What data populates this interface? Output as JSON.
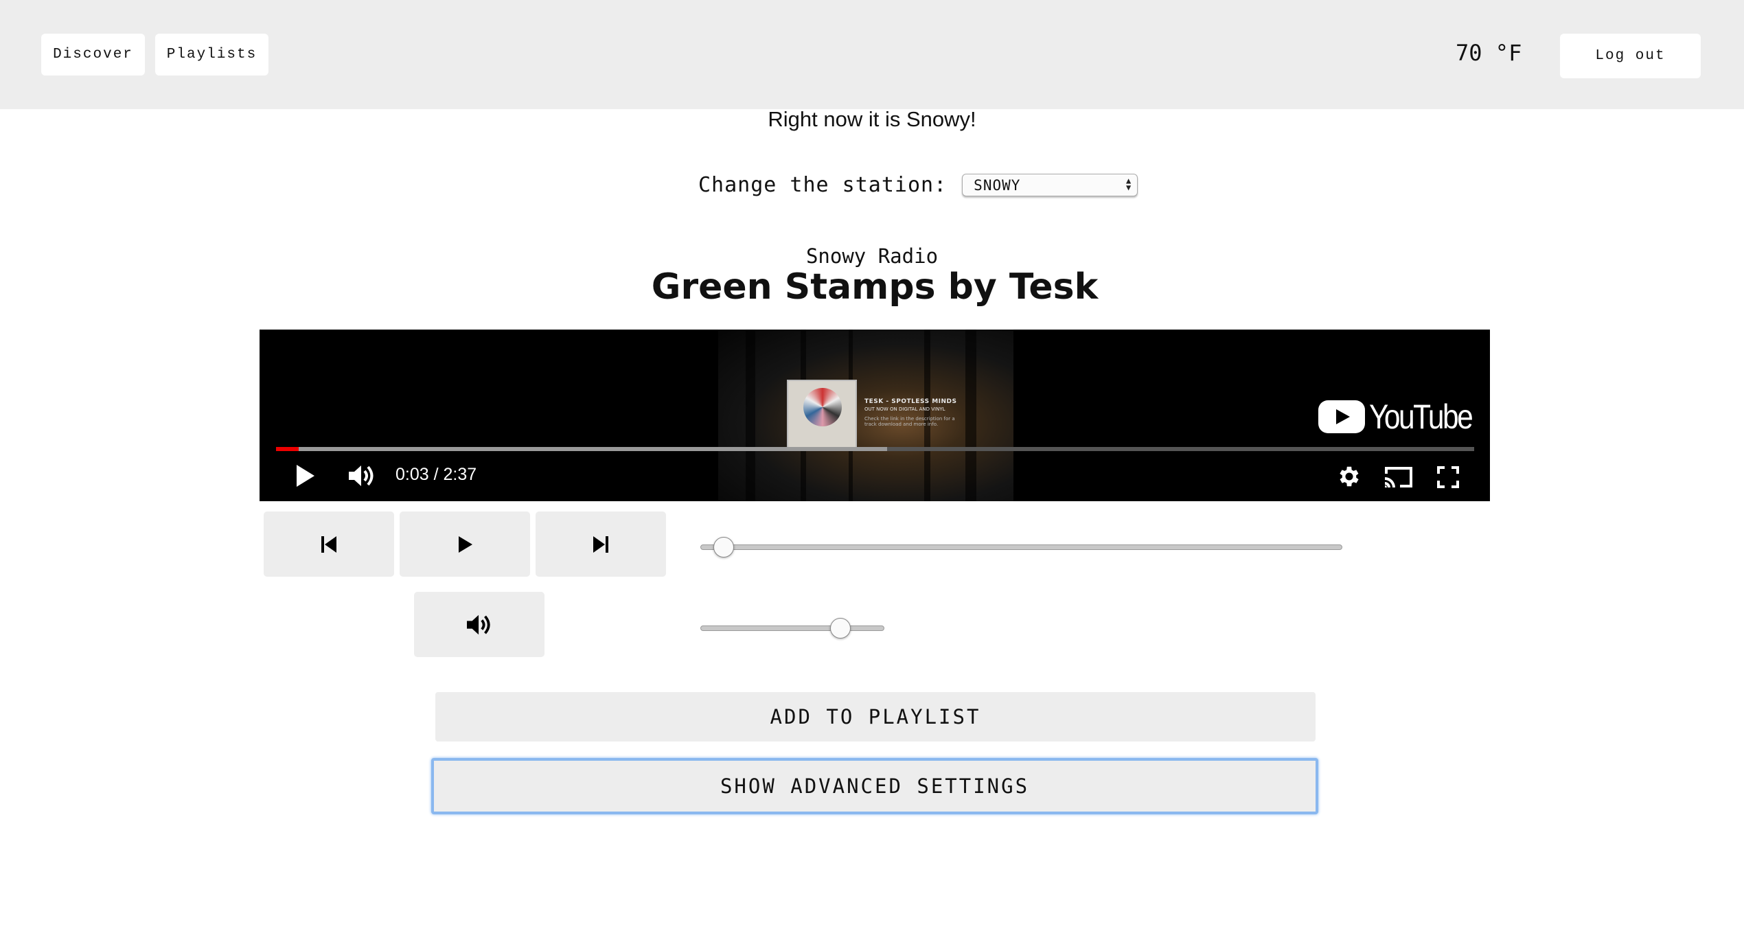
{
  "nav": {
    "discover_label": "Discover",
    "playlists_label": "Playlists",
    "temperature": "70 °F",
    "logout_label": "Log out"
  },
  "weather": {
    "message": "Right now it is Snowy!"
  },
  "station": {
    "label": "Change the station:",
    "selected": "SNOWY"
  },
  "now_playing": {
    "station_name": "Snowy Radio",
    "title": "Green Stamps by Tesk"
  },
  "video": {
    "brand_text": "YouTube",
    "promo_title": "TESK - SPOTLESS MINDS",
    "promo_subtitle": "OUT NOW ON DIGITAL AND VINYL",
    "promo_note": "Check the link in the description for a track download and more info.",
    "time_display": "0:03 / 2:37",
    "played_fraction": 0.019,
    "buffered_fraction": 0.51
  },
  "controls": {
    "seek_fraction": 0.036,
    "volume_fraction": 0.76
  },
  "actions": {
    "add_to_playlist_label": "ADD TO PLAYLIST",
    "advanced_settings_label": "SHOW ADVANCED SETTINGS"
  },
  "colors": {
    "header_bg": "#ededed",
    "progress_played": "#e00000",
    "focus_ring": "#8ab8ef"
  }
}
